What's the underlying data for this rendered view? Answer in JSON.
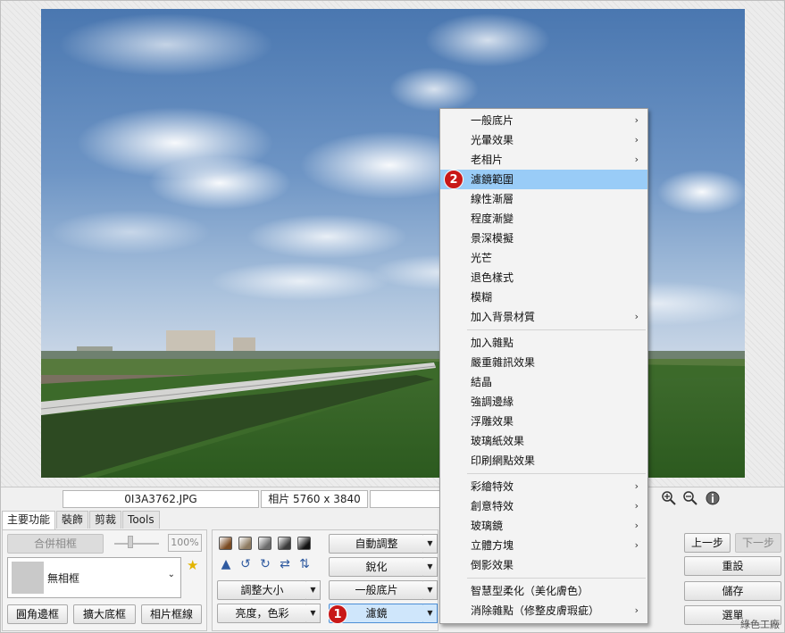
{
  "info": {
    "filename": "0I3A3762.JPG",
    "dimensions": "相片 5760 x 3840"
  },
  "tabs": [
    "主要功能",
    "裝飾",
    "剪裁",
    "Tools"
  ],
  "frame_panel": {
    "merge_label": "合併相框",
    "zoom_value": "100%",
    "frame_select": "無相框",
    "buttons": [
      "圓角邊框",
      "擴大底框",
      "相片框線"
    ]
  },
  "adjust": {
    "resize": "調整大小",
    "brightness": "亮度，色彩"
  },
  "effects": {
    "auto": "自動調整",
    "sharpen": "銳化",
    "film": "一般底片",
    "filter": "濾鏡"
  },
  "history": {
    "undo": "上一步",
    "redo": "下一步",
    "reset": "重設",
    "save": "儲存",
    "select": "選單"
  },
  "badges": {
    "b1": "1",
    "b2": "2"
  },
  "menu": {
    "groups": [
      [
        {
          "label": "一般底片",
          "sub": true
        },
        {
          "label": "光暈效果",
          "sub": true
        },
        {
          "label": "老相片",
          "sub": true
        },
        {
          "label": "濾鏡範圍",
          "sub": false,
          "highlight": true
        },
        {
          "label": "線性漸層",
          "sub": false
        },
        {
          "label": "程度漸變",
          "sub": false
        },
        {
          "label": "景深模擬",
          "sub": false
        },
        {
          "label": "光芒",
          "sub": false
        },
        {
          "label": "退色樣式",
          "sub": false
        },
        {
          "label": "模糊",
          "sub": false
        },
        {
          "label": "加入背景材質",
          "sub": true
        }
      ],
      [
        {
          "label": "加入雜點",
          "sub": false
        },
        {
          "label": "嚴重雜訊效果",
          "sub": false
        },
        {
          "label": "結晶",
          "sub": false
        },
        {
          "label": "強調邊緣",
          "sub": false
        },
        {
          "label": "浮雕效果",
          "sub": false
        },
        {
          "label": "玻璃紙效果",
          "sub": false
        },
        {
          "label": "印刷網點效果",
          "sub": false
        }
      ],
      [
        {
          "label": "彩繪特效",
          "sub": true
        },
        {
          "label": "創意特效",
          "sub": true
        },
        {
          "label": "玻璃鏡",
          "sub": true
        },
        {
          "label": "立體方塊",
          "sub": true
        },
        {
          "label": "倒影效果",
          "sub": false
        }
      ],
      [
        {
          "label": "智慧型柔化（美化膚色）",
          "sub": false
        },
        {
          "label": "消除雜點（修整皮膚瑕疵）",
          "sub": true
        }
      ]
    ]
  },
  "watermark": "綠色工廠",
  "colors": {
    "menu_highlight": "#99ccf7",
    "badge_red": "#c81818"
  },
  "swatches": [
    "#7a4a22",
    "#8d7a60",
    "#6b6b6b",
    "#3a3a3a",
    "#111111"
  ]
}
